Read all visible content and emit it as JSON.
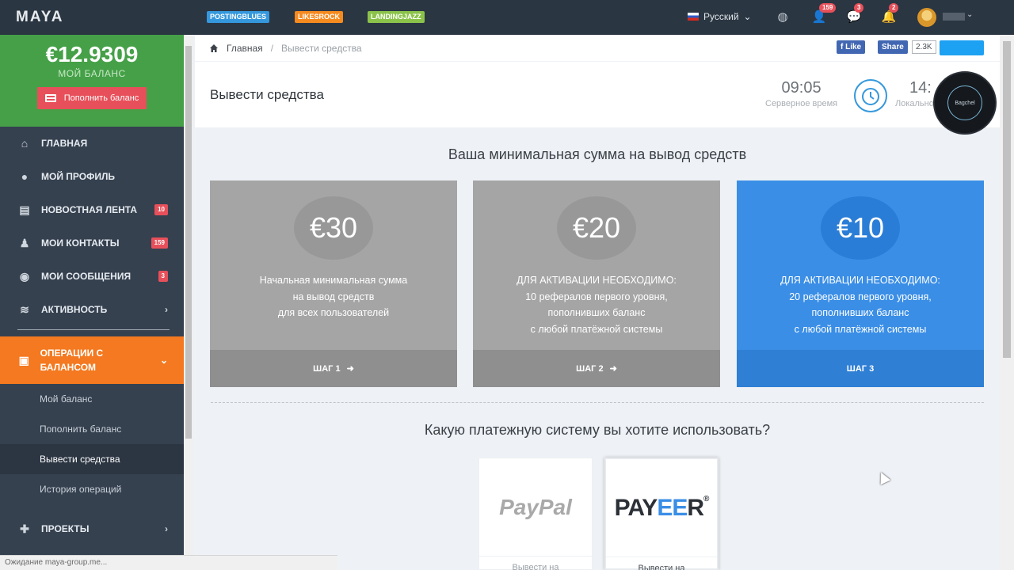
{
  "topbar": {
    "logo": "MAYA",
    "tags": [
      "POSTINGBLUES",
      "LIKESROCK",
      "LANDINGJAZZ"
    ],
    "language": "Русский",
    "badges": {
      "contacts": "159",
      "messages": "3",
      "notifications": "2"
    }
  },
  "sidebar": {
    "balance_amount": "€12.9309",
    "balance_label": "МОЙ БАЛАНС",
    "topup_button": "Пополнить баланс",
    "items": [
      {
        "label": "ГЛАВНАЯ",
        "icon": "home-icon"
      },
      {
        "label": "МОЙ ПРОФИЛЬ",
        "icon": "user-icon"
      },
      {
        "label": "НОВОСТНАЯ ЛЕНТА",
        "icon": "newspaper-icon",
        "badge": "10"
      },
      {
        "label": "МОИ КОНТАКТЫ",
        "icon": "contacts-icon",
        "badge": "159"
      },
      {
        "label": "МОИ СООБЩЕНИЯ",
        "icon": "chat-icon",
        "badge": "3"
      },
      {
        "label": "АКТИВНОСТЬ",
        "icon": "wifi-icon"
      }
    ],
    "active_item": "ОПЕРАЦИИ С БАЛАНСОМ",
    "sub_items": [
      "Мой баланс",
      "Пополнить баланс",
      "Вывести средства",
      "История операций"
    ],
    "projects": "ПРОЕКТЫ"
  },
  "breadcrumb": {
    "home": "Главная",
    "current": "Вывести средства"
  },
  "social": {
    "like": "Like",
    "share": "Share",
    "count": "2.3K"
  },
  "page": {
    "title": "Вывести средства",
    "server_time": "09:05",
    "server_time_label": "Серверное время",
    "local_time": "14:",
    "local_time_label": "Локальное в"
  },
  "section_min": "Ваша минимальная сумма на вывод средств",
  "plans": [
    {
      "amount": "€30",
      "lines": [
        "Начальная минимальная сумма",
        "на вывод средств",
        "для всех пользователей"
      ],
      "step": "ШАГ 1"
    },
    {
      "amount": "€20",
      "lines": [
        "ДЛЯ АКТИВАЦИИ НЕОБХОДИМО:",
        "10 рефералов первого уровня,",
        "пополнивших баланс",
        "с любой платёжной системы"
      ],
      "step": "ШАГ 2"
    },
    {
      "amount": "€10",
      "lines": [
        "ДЛЯ АКТИВАЦИИ НЕОБХОДИМО:",
        "20 рефералов первого уровня,",
        "пополнивших баланс",
        "с любой платёжной системы"
      ],
      "step": "ШАГ 3"
    }
  ],
  "section_pay": "Какую платежную систему вы хотите использовать?",
  "payments": [
    {
      "name": "PayPal",
      "label": "Вывести на"
    },
    {
      "name": "PAYEER",
      "label": "Вывести на"
    }
  ],
  "status_bar": "Ожидание maya-group.me...",
  "channel_logo": "Bagchel"
}
